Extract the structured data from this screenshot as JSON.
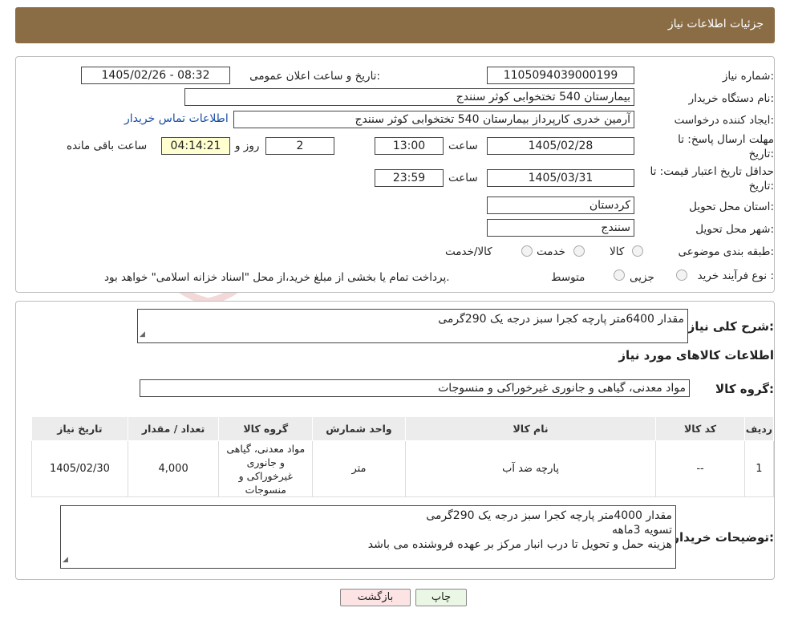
{
  "header": {
    "title": "جزئیات اطلاعات نیاز"
  },
  "need_number": {
    "label": "شماره نیاز:",
    "value": "1105094039000199"
  },
  "announce": {
    "label": "تاریخ و ساعت اعلان عمومی:",
    "value": "1405/02/26 - 08:32"
  },
  "buyer_org": {
    "label": "نام دستگاه خریدار:",
    "value": "بیمارستان 540 تختخوابی کوثر سنندج"
  },
  "requester": {
    "label": "ایجاد کننده درخواست:",
    "value": "آرمین خدری کارپرداز بیمارستان 540 تختخوابی کوثر سنندج",
    "contact_link": "اطلاعات تماس خریدار"
  },
  "deadline": {
    "label_1": "مهلت ارسال پاسخ: تا",
    "label_2": "تاریخ:",
    "date": "1405/02/28",
    "time_label": "ساعت",
    "time": "13:00",
    "days": "2",
    "days_label": "روز و",
    "remaining": "04:14:21",
    "remaining_label": "ساعت باقی مانده"
  },
  "validity": {
    "label_1": "حداقل تاریخ اعتبار قیمت: تا",
    "label_2": "تاریخ:",
    "date": "1405/03/31",
    "time_label": "ساعت",
    "time": "23:59"
  },
  "province": {
    "label": "استان محل تحویل:",
    "value": "کردستان"
  },
  "city": {
    "label": "شهر محل تحویل:",
    "value": "سنندج"
  },
  "category": {
    "label": "طبقه بندی موضوعی:",
    "options": [
      "کالا",
      "خدمت",
      "کالا/خدمت"
    ]
  },
  "purchase_type": {
    "label": "نوع فرآیند خرید :",
    "options": [
      "جزیی",
      "متوسط"
    ],
    "note": "پرداخت تمام یا بخشی از مبلغ خرید،از محل \"اسناد خزانه اسلامی\" خواهد بود."
  },
  "summary": {
    "label": "شرح کلی نیاز:",
    "value": "مقدار 6400متر پارچه کجرا سبز درجه یک 290گرمی"
  },
  "goods_info": {
    "title": "اطلاعات کالاهای مورد نیاز"
  },
  "goods_group": {
    "label": "گروه کالا:",
    "value": "مواد معدنی، گیاهی و جانوری غیرخوراکی و منسوجات"
  },
  "table": {
    "headers": [
      "ردیف",
      "کد کالا",
      "نام کالا",
      "واحد شمارش",
      "گروه کالا",
      "تعداد / مقدار",
      "تاریخ نیاز"
    ],
    "rows": [
      [
        "1",
        "--",
        "پارچه ضد آب",
        "متر",
        "مواد معدنی، گیاهی و جانوری غیرخوراکی و منسوجات",
        "4,000",
        "1405/02/30"
      ]
    ]
  },
  "buyer_notes": {
    "label": "توضیحات خریدار:",
    "lines": [
      "مقدار 4000متر پارچه کجرا سبز درجه یک 290گرمی",
      "تسویه 3ماهه",
      "هزینه حمل و تحویل تا درب انبار مرکز بر عهده فروشنده می باشد"
    ]
  },
  "buttons": {
    "print": "چاپ",
    "back": "بازگشت"
  },
  "watermark": {
    "text": "AriaTender.neT"
  },
  "colors": {
    "header_bg": "#8a6d45",
    "link": "#1a4fa3",
    "highlight": "#ffffd0",
    "back_button": "#fde4e4",
    "print_button": "#eaf7e4"
  }
}
